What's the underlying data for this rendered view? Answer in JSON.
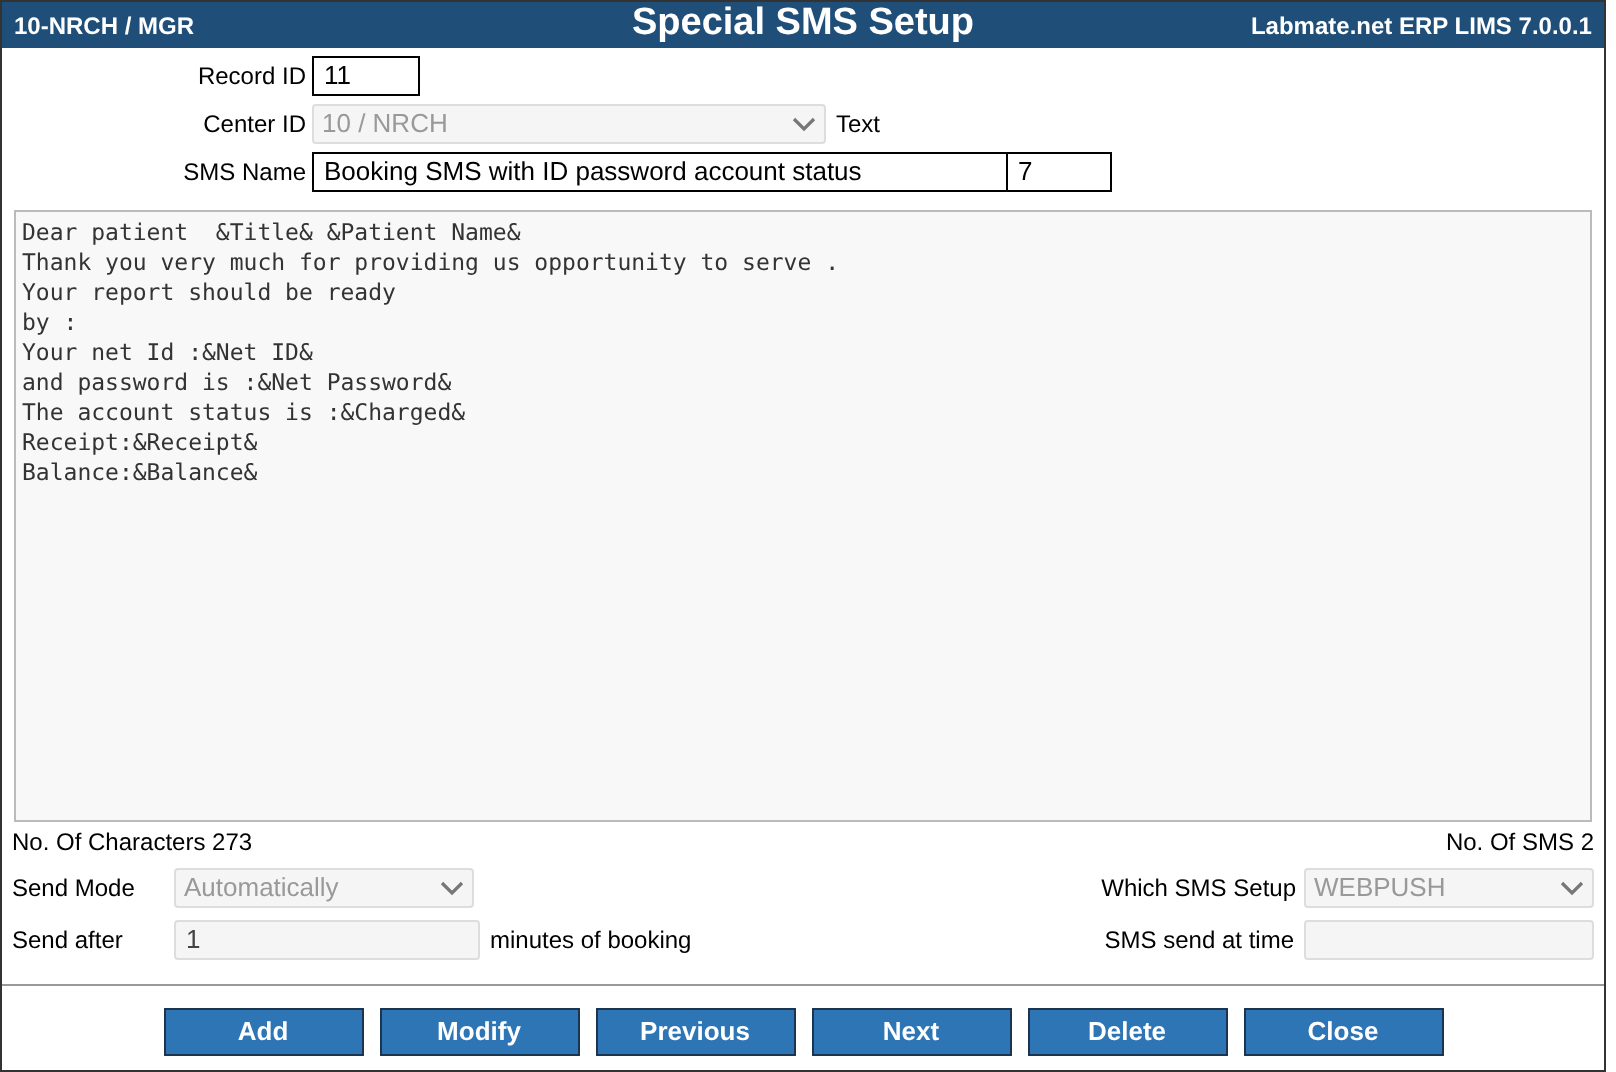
{
  "header": {
    "left": "10-NRCH / MGR",
    "title": "Special SMS Setup",
    "right": "Labmate.net ERP LIMS 7.0.0.1"
  },
  "record_id": {
    "label": "Record ID",
    "value": "11"
  },
  "center_id": {
    "label": "Center ID",
    "value": "10 / NRCH",
    "disabled": true,
    "suffix": "Text"
  },
  "sms_name": {
    "label": "SMS Name",
    "value": "Booking SMS with ID password account status",
    "code": "7"
  },
  "message": "Dear patient  &Title& &Patient Name&\nThank you very much for providing us opportunity to serve .\nYour report should be ready\nby :\nYour net Id :&Net ID&\nand password is :&Net Password&\nThe account status is :&Charged&\nReceipt:&Receipt&\nBalance:&Balance&",
  "char_count": "No. Of Characters 273",
  "sms_count": "No. Of SMS 2",
  "send_mode": {
    "label": "Send Mode",
    "value": "Automatically",
    "disabled": true
  },
  "which_setup": {
    "label": "Which SMS Setup",
    "value": "WEBPUSH",
    "disabled": true
  },
  "send_after": {
    "label": "Send after",
    "value": "1",
    "suffix": "minutes of booking",
    "disabled": true
  },
  "send_at_time": {
    "label": "SMS send at time",
    "disabled": true
  },
  "buttons": [
    "Add",
    "Modify",
    "Previous",
    "Next",
    "Delete",
    "Close"
  ]
}
